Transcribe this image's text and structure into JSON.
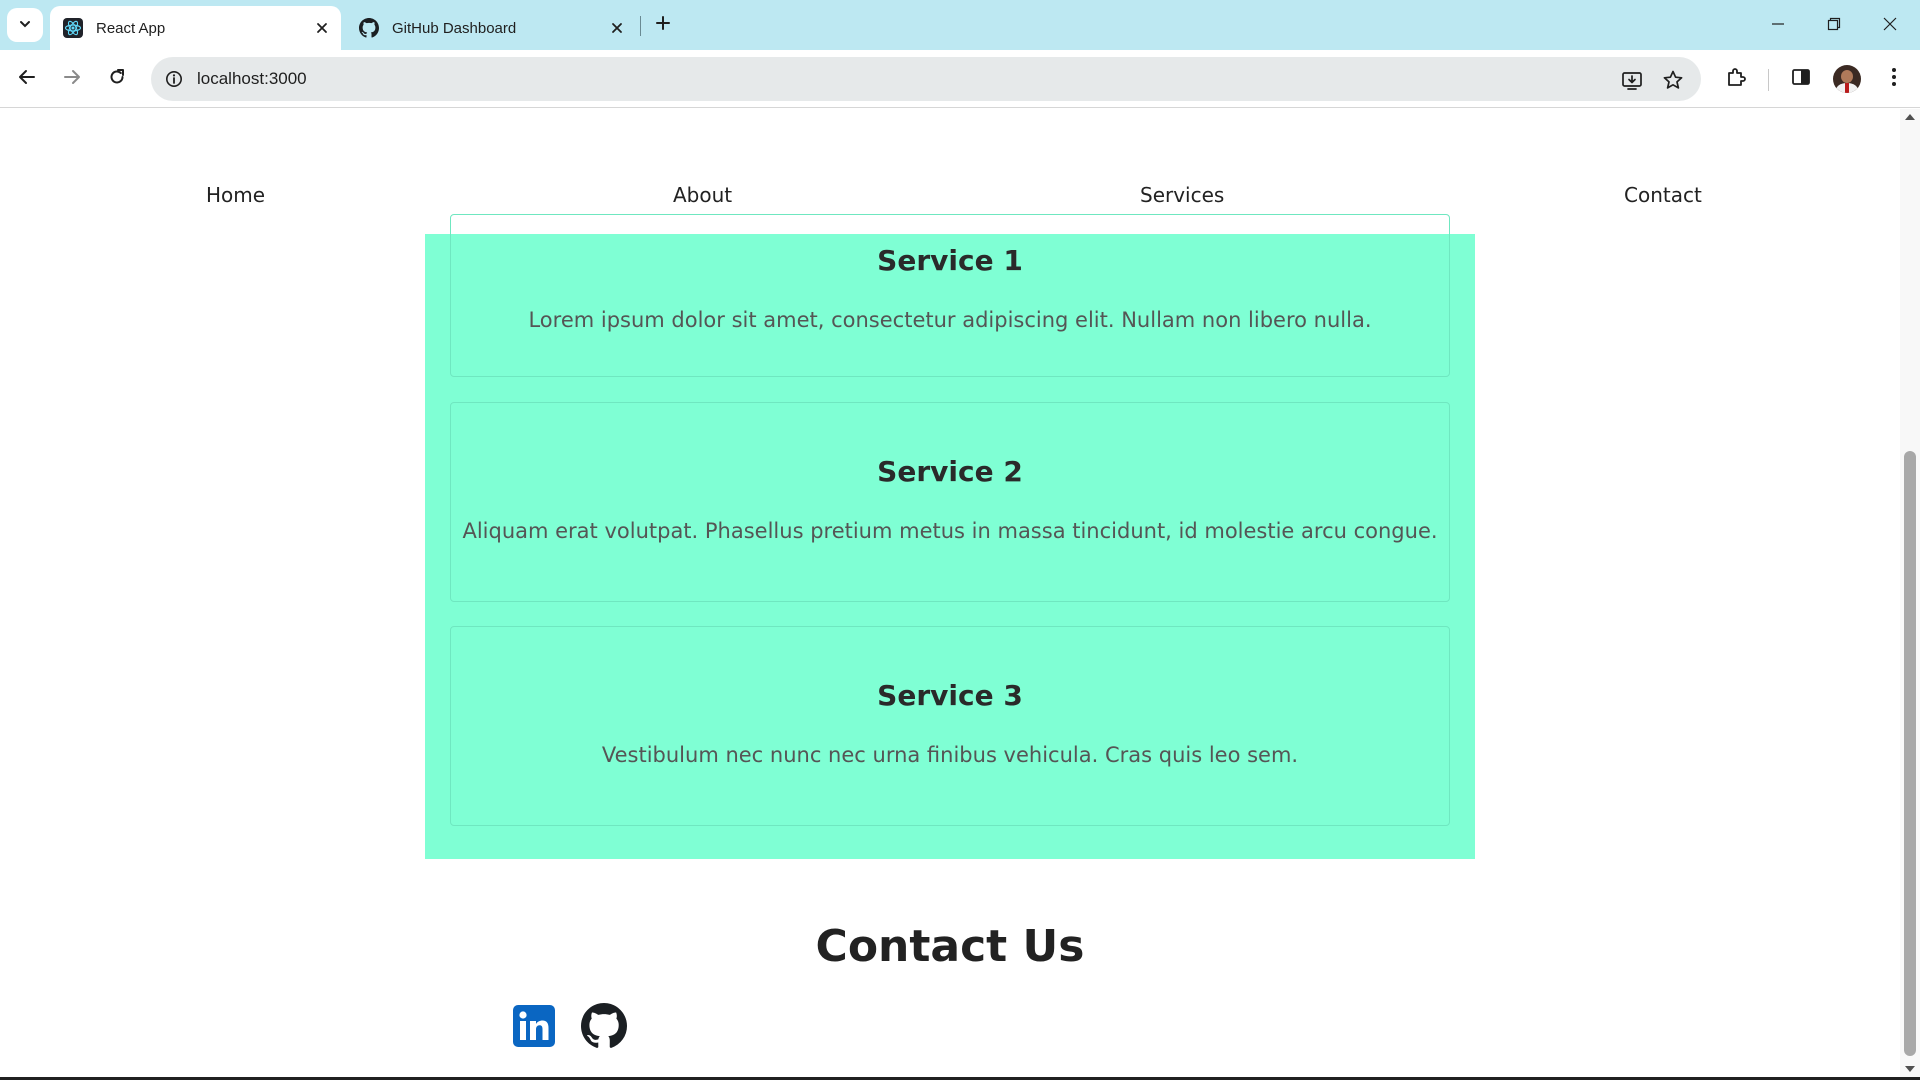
{
  "browser": {
    "tabs": [
      {
        "title": "React App",
        "active": true,
        "favicon": "react-icon"
      },
      {
        "title": "GitHub Dashboard",
        "active": false,
        "favicon": "github-icon"
      }
    ],
    "url": "localhost:3000",
    "accent": "#bde8f2"
  },
  "site": {
    "nav": {
      "home": "Home",
      "about": "About",
      "services": "Services",
      "contact": "Contact"
    },
    "services_bg": "#7fffd4",
    "services": [
      {
        "title": "Service 1",
        "text": "Lorem ipsum dolor sit amet, consectetur adipiscing elit. Nullam non libero nulla."
      },
      {
        "title": "Service 2",
        "text": "Aliquam erat volutpat. Phasellus pretium metus in massa tincidunt, id molestie arcu congue."
      },
      {
        "title": "Service 3",
        "text": "Vestibulum nec nunc nec urna finibus vehicula. Cras quis leo sem."
      }
    ],
    "contact": {
      "title": "Contact Us",
      "links": [
        {
          "name": "linkedin-icon",
          "color": "#0a66c2"
        },
        {
          "name": "github-icon",
          "color": "#1b1f23"
        }
      ]
    }
  }
}
